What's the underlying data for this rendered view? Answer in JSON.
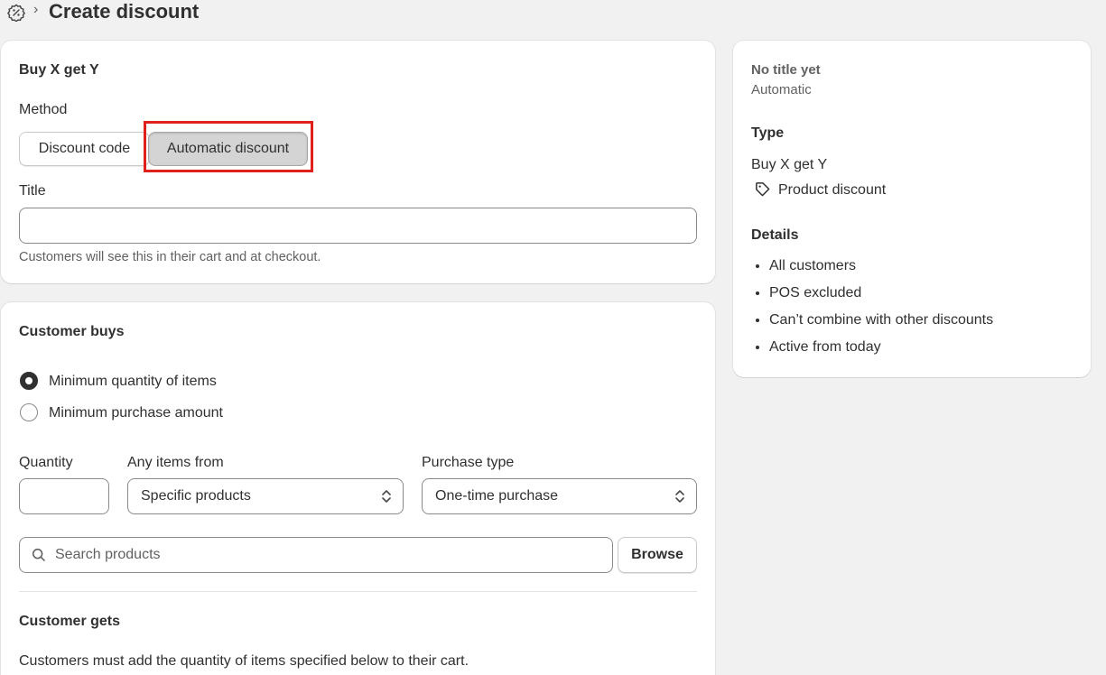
{
  "header": {
    "title": "Create discount",
    "icon": "discount-icon"
  },
  "method_card": {
    "heading": "Buy X get Y",
    "method_label": "Method",
    "options": [
      "Discount code",
      "Automatic discount"
    ],
    "selected": "Automatic discount",
    "title_label": "Title",
    "title_value": "",
    "title_help": "Customers will see this in their cart and at checkout."
  },
  "customer_buys": {
    "heading": "Customer buys",
    "radio_options": [
      "Minimum quantity of items",
      "Minimum purchase amount"
    ],
    "selected": "Minimum quantity of items",
    "quantity_label": "Quantity",
    "quantity_value": "",
    "items_label": "Any items from",
    "items_value": "Specific products",
    "purchase_label": "Purchase type",
    "purchase_value": "One-time purchase",
    "search_placeholder": "Search products",
    "browse_label": "Browse"
  },
  "customer_gets": {
    "heading": "Customer gets",
    "help": "Customers must add the quantity of items specified below to their cart."
  },
  "summary": {
    "title": "No title yet",
    "subtitle": "Automatic",
    "type_heading": "Type",
    "type_value": "Buy X get Y",
    "type_detail": "Product discount",
    "details_heading": "Details",
    "details": [
      "All customers",
      "POS excluded",
      "Can’t combine with other discounts",
      "Active from today"
    ]
  },
  "colors": {
    "highlight": "#e0201c",
    "background": "#f1f1f1"
  }
}
